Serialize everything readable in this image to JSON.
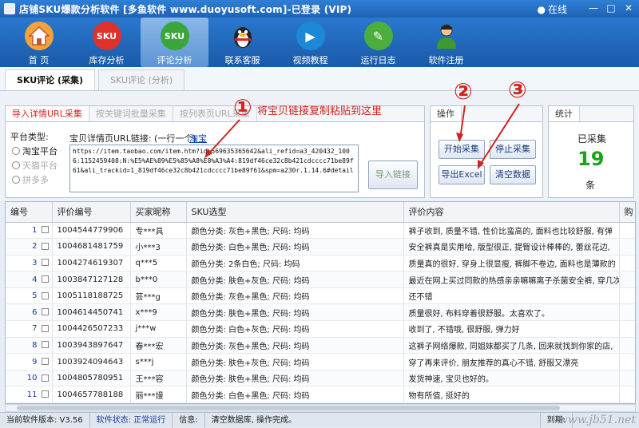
{
  "window": {
    "title": "店铺SKU爆款分析软件 [多鱼软件 www.duoyusoft.com]-已登录 (VIP)",
    "online_status": "在线",
    "controls": [
      "—",
      "□",
      "✕"
    ]
  },
  "toolbar": {
    "items": [
      {
        "label": "首 页",
        "icon": "home-icon",
        "color": "#f4a23a",
        "text": ""
      },
      {
        "label": "库存分析",
        "icon": "sku-red-icon",
        "color": "#e0302a",
        "text": "SKU"
      },
      {
        "label": "评论分析",
        "icon": "sku-green-icon",
        "color": "#3aa53a",
        "text": "SKU"
      },
      {
        "label": "联系客服",
        "icon": "qq-penguin-icon",
        "color": "#222222",
        "text": ""
      },
      {
        "label": "视频教程",
        "icon": "play-icon",
        "color": "#1e88d8",
        "text": "▶"
      },
      {
        "label": "运行日志",
        "icon": "log-icon",
        "color": "#4cae3c",
        "text": "✎"
      },
      {
        "label": "软件注册",
        "icon": "user-register-icon",
        "color": "#3c9a2e",
        "text": ""
      }
    ]
  },
  "subtabs": [
    "SKU评论 (采集)",
    "SKU评论 (分析)"
  ],
  "collect": {
    "tabs": [
      "导入详情URL采集",
      "按关键词批量采集",
      "按列表页URL采集"
    ],
    "platform_label": "平台类型:",
    "platforms": [
      "淘宝平台",
      "天猫平台",
      "拼多多"
    ],
    "url_label": "宝贝详情页URL链接: (一行一个)",
    "taobao_link": "淘宝",
    "url_value": "https://item.taobao.com/item.htm?id=569635365642&ali_refid=a3_420432_1006:1152459408:N:%E5%AE%89%E5%85%A8%E8%A3%A4:819df46ce32c8b421cdcccc71be89f61&ali_trackid=1_819df46ce32c8b421cdcccc71be89f61&spm=a230r.1.14.6#detail",
    "import_button": "导入链接",
    "annotation": "将宝贝链接复制粘贴到这里"
  },
  "ops": {
    "title": "操作",
    "start": "开始采集",
    "stop": "停止采集",
    "export": "导出Excel",
    "clear": "清空数据"
  },
  "stats": {
    "title": "统计",
    "label": "已采集",
    "count": "19",
    "unit": "条"
  },
  "annotations": {
    "one": "①",
    "two": "②",
    "three": "③"
  },
  "table": {
    "headers": [
      "编号",
      "评价编号",
      "买家昵称",
      "SKU选型",
      "评价内容",
      "购"
    ],
    "rows": [
      [
        "1",
        "1004544779906",
        "专***具",
        "颜色分类: 灰色+黑色; 尺码: 均码",
        "裤子收到, 质量不错, 性价比蛮高的, 面料也比较舒服, 有弹"
      ],
      [
        "2",
        "1004681481759",
        "小***3",
        "颜色分类: 白色+黑色; 尺码: 均码",
        "安全裤真是实用哈, 版型很正, 提臀设计棒棒的, 蕾丝花边,"
      ],
      [
        "3",
        "1004274619307",
        "q***5",
        "颜色分类: 2条白色; 尺码: 均码",
        "质量真的很好, 穿身上很显瘦, 裤脚不卷边, 面料也是薄款的"
      ],
      [
        "4",
        "1003847127128",
        "b***0",
        "颜色分类: 肤色+灰色; 尺码: 均码",
        "最近在网上买过同款的热感亲亲嘛嘛离子杀菌安全裤, 穿几次"
      ],
      [
        "5",
        "1005118188725",
        "芸***g",
        "颜色分类: 灰色+黑色; 尺码: 均码",
        "还不错"
      ],
      [
        "6",
        "1004614450741",
        "x***9",
        "颜色分类: 肤色+黑色; 尺码: 均码",
        "质量很好, 布料穿着很舒服。太喜欢了。"
      ],
      [
        "7",
        "1004426507233",
        "j***w",
        "颜色分类: 白色+灰色; 尺码: 均码",
        "收到了, 不错哦, 很舒服, 弹力好"
      ],
      [
        "8",
        "1003943897647",
        "春***宏",
        "颜色分类: 灰色+黑色; 尺码: 均码",
        "这裤子网络爆款, 同姐妹都买了几条, 回来就找到你家的店,"
      ],
      [
        "9",
        "1003924094643",
        "s***j",
        "颜色分类: 肤色+灰色; 尺码: 均码",
        "穿了再来评价, 朋友推荐的真心不错, 舒服又漂亮"
      ],
      [
        "10",
        "1004805780951",
        "王***容",
        "颜色分类: 肤色+黑色; 尺码: 均码",
        "发货神速, 宝贝也好的。"
      ],
      [
        "11",
        "1004657788188",
        "丽***熳",
        "颜色分类: 白色+黑色; 尺码: 均码",
        "物有所值, 挺好的"
      ]
    ]
  },
  "statusbar": {
    "version": "当前软件版本: V3.56",
    "state_label": "软件状态:",
    "state_value": "正常运行",
    "info_label": "信息:",
    "info_value": "清空数据库, 操作完成。",
    "expiry_label": "到期:",
    "watermark": "www.jb51.net"
  }
}
